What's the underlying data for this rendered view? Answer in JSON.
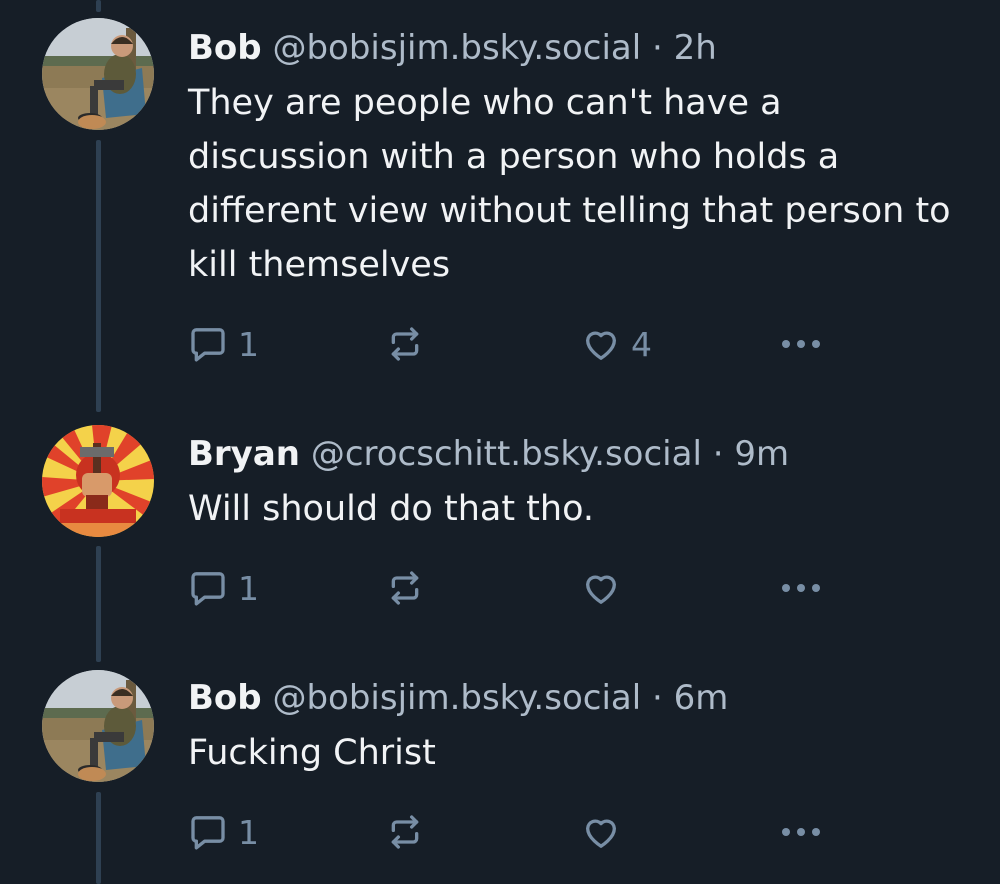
{
  "posts": [
    {
      "display_name": "Bob",
      "handle": "@bobisjim.bsky.social",
      "time": "2h",
      "text": "They are people who can't have a discussion with a person who holds a different view without telling that person to kill themselves",
      "reply_count": "1",
      "repost_count": "",
      "like_count": "4"
    },
    {
      "display_name": "Bryan",
      "handle": "@crocschitt.bsky.social",
      "time": "9m",
      "text": "Will should do that tho.",
      "reply_count": "1",
      "repost_count": "",
      "like_count": ""
    },
    {
      "display_name": "Bob",
      "handle": "@bobisjim.bsky.social",
      "time": "6m",
      "text": "Fucking Christ",
      "reply_count": "1",
      "repost_count": "",
      "like_count": ""
    }
  ],
  "separator": "·",
  "icons": {
    "reply": "reply-icon",
    "repost": "repost-icon",
    "like": "heart-icon",
    "more": "more-options-icon"
  },
  "colors": {
    "background": "#161e27",
    "text": "#f1f3f5",
    "muted": "#aebbc9",
    "icon": "#788ea5",
    "thread_line": "#2e4052"
  }
}
